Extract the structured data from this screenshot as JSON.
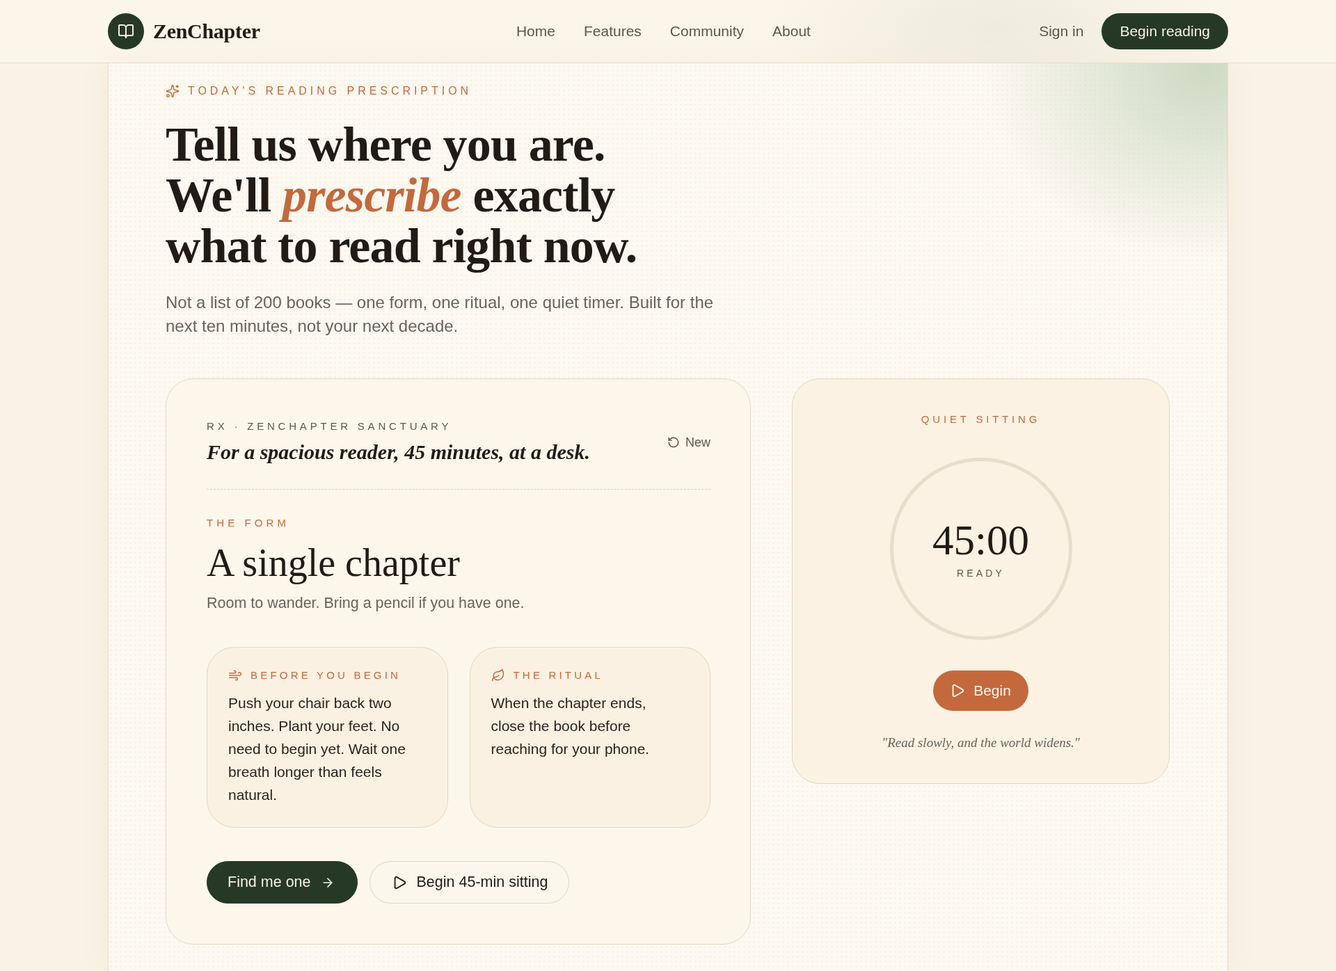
{
  "header": {
    "brand": "ZenChapter",
    "nav": [
      "Home",
      "Features",
      "Community",
      "About"
    ],
    "sign_in": "Sign in",
    "cta": "Begin reading"
  },
  "hero": {
    "eyebrow": "TODAY'S READING PRESCRIPTION",
    "headline": [
      "Tell us where you are.",
      "We'll *prescribe* exactly",
      "what to read right now."
    ],
    "lede": "Not a list of 200 books — one form, one ritual, one quiet timer. Built for the next ten minutes, not your next decade."
  },
  "prescription": {
    "meta": "RX · ZENCHAPTER SANCTUARY",
    "summary": "For a spacious reader, 45 minutes, at a desk.",
    "refresh": "New",
    "form_label": "THE FORM",
    "form_title": "A single chapter",
    "form_note": "Room to wander. Bring a pencil if you have one.",
    "steps": [
      {
        "label": "BEFORE YOU BEGIN",
        "text": "Push your chair back two inches. Plant your feet. No need to begin yet. Wait one breath longer than feels natural."
      },
      {
        "label": "THE RITUAL",
        "text": "When the chapter ends, close the book before reaching for your phone."
      }
    ],
    "actions": [
      {
        "kind": "primary",
        "label": "Find me one"
      },
      {
        "kind": "outline",
        "label": "Begin 45-min sitting"
      }
    ]
  },
  "timer": {
    "label": "QUIET SITTING",
    "time": "45:00",
    "status": "READY",
    "action": "Begin",
    "quote": "\"Read slowly, and the world widens.\""
  }
}
